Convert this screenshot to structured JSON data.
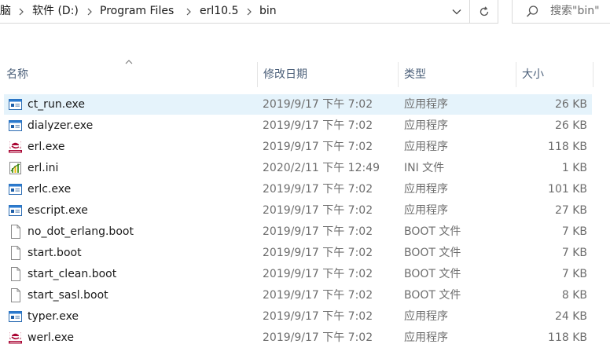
{
  "address_bar": {
    "crumbs": [
      "脑",
      "软件 (D:)",
      "Program Files",
      "erl10.5",
      "bin"
    ]
  },
  "search": {
    "placeholder": "搜索\"bin\""
  },
  "columns": {
    "name": "名称",
    "date": "修改日期",
    "type": "类型",
    "size": "大小"
  },
  "files": [
    {
      "name": "ct_run.exe",
      "date": "2019/9/17 下午 7:02",
      "type": "应用程序",
      "size": "26 KB",
      "icon": "app-window-icon",
      "selected": true
    },
    {
      "name": "dialyzer.exe",
      "date": "2019/9/17 下午 7:02",
      "type": "应用程序",
      "size": "26 KB",
      "icon": "app-window-icon"
    },
    {
      "name": "erl.exe",
      "date": "2019/9/17 下午 7:02",
      "type": "应用程序",
      "size": "118 KB",
      "icon": "erlang-logo-icon"
    },
    {
      "name": "erl.ini",
      "date": "2020/2/11 下午 12:49",
      "type": "INI 文件",
      "size": "1 KB",
      "icon": "ini-settings-icon"
    },
    {
      "name": "erlc.exe",
      "date": "2019/9/17 下午 7:02",
      "type": "应用程序",
      "size": "101 KB",
      "icon": "app-window-icon"
    },
    {
      "name": "escript.exe",
      "date": "2019/9/17 下午 7:02",
      "type": "应用程序",
      "size": "27 KB",
      "icon": "app-window-icon"
    },
    {
      "name": "no_dot_erlang.boot",
      "date": "2019/9/17 下午 7:02",
      "type": "BOOT 文件",
      "size": "7 KB",
      "icon": "blank-file-icon"
    },
    {
      "name": "start.boot",
      "date": "2019/9/17 下午 7:02",
      "type": "BOOT 文件",
      "size": "7 KB",
      "icon": "blank-file-icon"
    },
    {
      "name": "start_clean.boot",
      "date": "2019/9/17 下午 7:02",
      "type": "BOOT 文件",
      "size": "7 KB",
      "icon": "blank-file-icon"
    },
    {
      "name": "start_sasl.boot",
      "date": "2019/9/17 下午 7:02",
      "type": "BOOT 文件",
      "size": "8 KB",
      "icon": "blank-file-icon"
    },
    {
      "name": "typer.exe",
      "date": "2019/9/17 下午 7:02",
      "type": "应用程序",
      "size": "24 KB",
      "icon": "app-window-icon"
    },
    {
      "name": "werl.exe",
      "date": "2019/9/17 下午 7:02",
      "type": "应用程序",
      "size": "118 KB",
      "icon": "erlang-logo-icon"
    }
  ],
  "colors": {
    "selected_row": "#e5f3fb",
    "header_text": "#4c607a",
    "erlang_red": "#a90533"
  }
}
